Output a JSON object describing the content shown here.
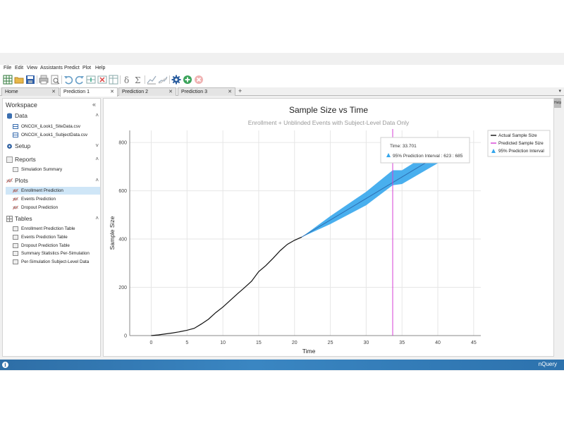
{
  "window": {
    "title": "nQuery",
    "minimize": "−",
    "maximize": "❐",
    "close": "✕"
  },
  "menu": [
    "File",
    "Edit",
    "View",
    "Assistants",
    "Predict",
    "Plot",
    "Help"
  ],
  "toolbar": {
    "icons": [
      "grid-icon",
      "open-folder-icon",
      "save-icon",
      "print-icon",
      "print-preview-icon",
      "undo-icon",
      "redo-icon",
      "insert-rows-icon",
      "delete-rows-icon",
      "table-icon",
      "delta-icon",
      "sigma-icon",
      "plot-icon",
      "compare-plot-icon",
      "gear-icon",
      "add-circle-icon",
      "remove-circle-icon"
    ]
  },
  "tabs": [
    {
      "label": "Home",
      "close": "✕",
      "active": false
    },
    {
      "label": "Prediction 1",
      "close": "✕",
      "active": true
    },
    {
      "label": "Prediction 2",
      "close": "✕",
      "active": false
    },
    {
      "label": "Prediction 3",
      "close": "✕",
      "active": false
    }
  ],
  "tab_add": "+",
  "tab_scroll": "▾",
  "sidebar": {
    "title": "Workspace",
    "collapse": "«",
    "sections": {
      "data": {
        "label": "Data",
        "toggle": "˄",
        "items": [
          "ONCOX_iLook1_SiteData.csv",
          "ONCOX_iLook1_SubjectData.csv"
        ]
      },
      "setup": {
        "label": "Setup",
        "toggle": "˅"
      },
      "reports": {
        "label": "Reports",
        "toggle": "˄",
        "items": [
          "Simulation Summary"
        ]
      },
      "plots": {
        "label": "Plots",
        "toggle": "˄",
        "items": [
          "Enrollment Prediction",
          "Events Prediction",
          "Dropout Prediction"
        ],
        "selected": 0
      },
      "tables": {
        "label": "Tables",
        "toggle": "˄",
        "items": [
          "Enrollment Prediction Table",
          "Events Prediction Table",
          "Dropout Prediction Table",
          "Summary Statistics Per-Simulation",
          "Per-Simulation Subject-Level Data"
        ]
      }
    }
  },
  "side_help": "Help",
  "status": {
    "info": "i",
    "brand": "nQuery"
  },
  "chart_data": {
    "type": "line",
    "title": "Sample Size vs Time",
    "subtitle": "Enrollment + Unblinded Events with Subject-Level Data Only",
    "xlabel": "Time",
    "ylabel": "Sample Size",
    "xlim": [
      -3,
      46
    ],
    "ylim": [
      0,
      850
    ],
    "xticks": [
      0,
      5,
      10,
      15,
      20,
      25,
      30,
      35,
      40,
      45
    ],
    "yticks": [
      0,
      200,
      400,
      600,
      800
    ],
    "grid": true,
    "legend_position": "top-right",
    "legend": [
      "Actual Sample Size",
      "Predicted Sample Size",
      "95% Prediction Interval"
    ],
    "colors": {
      "actual": "#111111",
      "predicted": "#2d6fb3",
      "interval": "#35a6ec",
      "cursor": "#d43fd4"
    },
    "series": [
      {
        "name": "Actual Sample Size",
        "x": [
          0,
          1,
          2,
          3,
          4,
          5,
          6,
          7,
          8,
          9,
          10,
          11,
          12,
          13,
          14,
          15,
          16,
          17,
          18,
          19,
          20,
          21
        ],
        "y": [
          0,
          3,
          7,
          11,
          16,
          22,
          30,
          48,
          68,
          95,
          118,
          145,
          172,
          198,
          225,
          265,
          290,
          320,
          352,
          378,
          395,
          408
        ]
      },
      {
        "name": "Predicted Sample Size",
        "x": [
          21,
          25,
          30,
          33.7,
          35,
          40
        ],
        "y": [
          408,
          479,
          568,
          634,
          657,
          746
        ]
      }
    ],
    "interval": {
      "x": [
        21,
        25,
        30,
        33.7,
        35,
        40
      ],
      "lower": [
        408,
        462,
        540,
        623,
        628,
        714
      ],
      "upper": [
        408,
        495,
        596,
        685,
        685,
        778
      ]
    },
    "cursor": {
      "x": 33.701
    },
    "tooltip": {
      "time_label": "Time: 33.701",
      "interval_label": "95% Prediction Interval : 623 : 685"
    }
  }
}
